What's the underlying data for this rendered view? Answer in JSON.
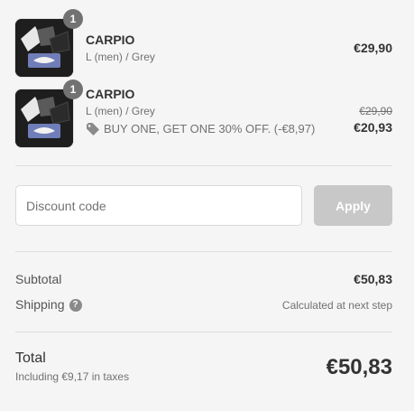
{
  "items": [
    {
      "quantity": "1",
      "name": "CARPIO",
      "variant": "L (men) / Grey",
      "price": "€29,90",
      "image_icon": "product-thumbnail"
    },
    {
      "quantity": "1",
      "name": "CARPIO",
      "variant": "L (men) / Grey",
      "original_price": "€29,90",
      "price": "€20,93",
      "discount": "BUY ONE, GET ONE 30% OFF. (-€8,97)",
      "discount_icon": "tag-icon",
      "image_icon": "product-thumbnail"
    }
  ],
  "discount_field": {
    "placeholder": "Discount code",
    "apply_label": "Apply"
  },
  "summary": {
    "subtotal_label": "Subtotal",
    "subtotal_value": "€50,83",
    "shipping_label": "Shipping",
    "shipping_value": "Calculated at next step",
    "help_icon": "?"
  },
  "total": {
    "label": "Total",
    "tax_note": "Including €9,17 in taxes",
    "value": "€50,83"
  },
  "colors": {
    "background": "#f5f5f5",
    "apply_disabled": "#c8c8c8",
    "badge": "#727272"
  }
}
